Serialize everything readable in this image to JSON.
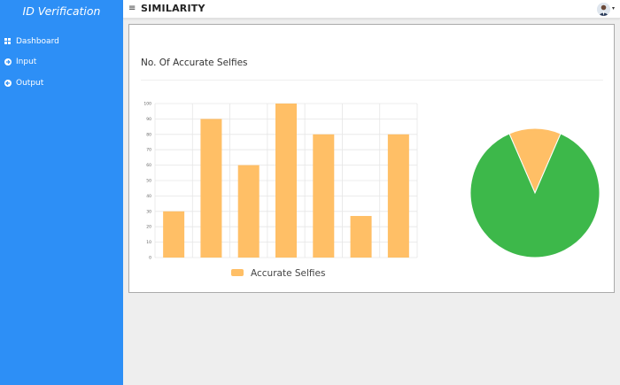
{
  "app": {
    "brand": "ID Verification"
  },
  "sidebar": {
    "items": [
      {
        "label": "Dashboard",
        "icon": "dashboard-grid-icon"
      },
      {
        "label": "Input",
        "icon": "arrow-right-circle-icon"
      },
      {
        "label": "Output",
        "icon": "arrow-left-circle-icon"
      }
    ]
  },
  "topbar": {
    "menu_icon": "≡",
    "title": "SIMILARITY",
    "caret": "▾"
  },
  "card": {
    "title": "No. Of Accurate Selfies"
  },
  "colors": {
    "sidebar": "#2d8ff6",
    "bar": "#ffbf66",
    "pie_green": "#3db84a",
    "pie_orange": "#ffbf66"
  },
  "chart_data": [
    {
      "type": "bar",
      "series": [
        {
          "name": "Accurate Selfies",
          "values": [
            30,
            90,
            60,
            100,
            80,
            27,
            80
          ]
        }
      ],
      "ylim": [
        0,
        100
      ],
      "yticks": [
        0,
        10,
        20,
        30,
        40,
        50,
        60,
        70,
        80,
        90,
        100
      ],
      "grid": true,
      "legend": "bottom"
    },
    {
      "type": "pie",
      "values": [
        87,
        13
      ]
    }
  ]
}
